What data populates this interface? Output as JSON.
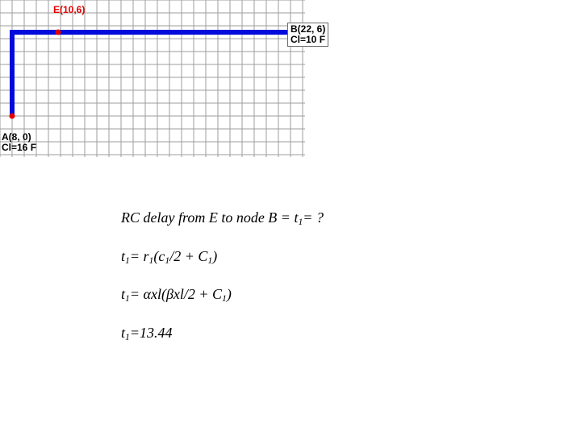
{
  "chart_data": {
    "type": "scatter",
    "title": "",
    "xlabel": "",
    "ylabel": "",
    "xlim": [
      0,
      24
    ],
    "ylim": [
      -1,
      9
    ],
    "grid": true,
    "grid_spacing": 1,
    "points": [
      {
        "name": "A",
        "x": 8,
        "y": 0,
        "label": "A(8, 0)",
        "sub": "Cl=16 F"
      },
      {
        "name": "E",
        "x": 10,
        "y": 6,
        "label": "E(10,6)",
        "sub": ""
      },
      {
        "name": "B",
        "x": 22,
        "y": 6,
        "label": "B(22, 6)",
        "sub": "Cl=10 F"
      }
    ],
    "wire_path": [
      {
        "x": 9,
        "y": 0
      },
      {
        "x": 9,
        "y": 6
      },
      {
        "x": 24,
        "y": 6
      }
    ],
    "wire_color": "#000bdc",
    "marker_color": "#e50000"
  },
  "labels": {
    "E": "E(10,6)",
    "B_line1": "B(22, 6)",
    "B_line2": "Cl=10 F",
    "A_line1": "A(8, 0)",
    "A_line2": "Cl=16 F"
  },
  "equations": {
    "q": "RC delay from E to node B = t₁= ?",
    "e1": "t₁= r₁(c₁/2 + C₁)",
    "e2": "t₁= αxl(βxl/2 + C₁)",
    "e3": "t₁=13.44"
  }
}
